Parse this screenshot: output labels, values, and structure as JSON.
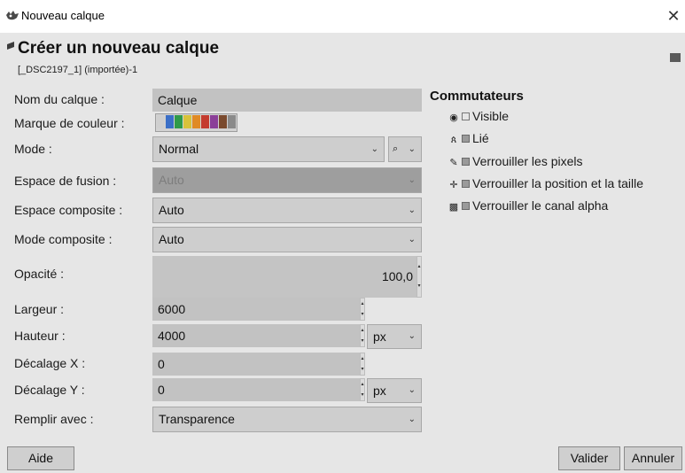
{
  "window": {
    "title": "Nouveau calque",
    "close_glyph": "✕"
  },
  "header": {
    "title": "Créer un nouveau calque",
    "subtitle": "[_DSC2197_1] (importée)-1"
  },
  "form": {
    "layer_name": {
      "label": "Nom du calque :",
      "value": "Calque"
    },
    "color_tag": {
      "label": "Marque de couleur :",
      "colors": [
        "#cfcfcf",
        "#3b6fc7",
        "#2f9a4a",
        "#d8c23a",
        "#e08a25",
        "#c43b2e",
        "#8b3f98",
        "#7a4a2e",
        "#8a8a8a"
      ]
    },
    "mode": {
      "label": "Mode :",
      "value": "Normal",
      "extra_glyph": "⌕"
    },
    "blend_space": {
      "label": "Espace de fusion :",
      "value": "Auto"
    },
    "composite_space": {
      "label": "Espace composite :",
      "value": "Auto"
    },
    "composite_mode": {
      "label": "Mode composite :",
      "value": "Auto"
    },
    "opacity": {
      "label": "Opacité :",
      "value": "100,0"
    },
    "width": {
      "label": "Largeur :",
      "value": "6000"
    },
    "height": {
      "label": "Hauteur :",
      "value": "4000",
      "unit": "px"
    },
    "offset_x": {
      "label": "Décalage X :",
      "value": "0"
    },
    "offset_y": {
      "label": "Décalage Y :",
      "value": "0",
      "unit": "px"
    },
    "fill": {
      "label": "Remplir avec :",
      "value": "Transparence"
    }
  },
  "switches": {
    "title": "Commutateurs",
    "items": [
      {
        "label": "Visible",
        "icon": "eye-icon",
        "glyph": "◉",
        "checked": false
      },
      {
        "label": "Lié",
        "icon": "chain-icon",
        "glyph": "ጰ",
        "checked": true
      },
      {
        "label": "Verrouiller les pixels",
        "icon": "brush-icon",
        "glyph": "✎",
        "checked": true
      },
      {
        "label": "Verrouiller la position et la taille",
        "icon": "move-icon",
        "glyph": "✛",
        "checked": true
      },
      {
        "label": "Verrouiller le canal alpha",
        "icon": "checkerboard-icon",
        "glyph": "▩",
        "checked": true
      }
    ]
  },
  "buttons": {
    "help": "Aide",
    "ok": "Valider",
    "cancel": "Annuler"
  },
  "glyphs": {
    "chevron": "⌄",
    "spin_up": "▴",
    "spin_down": "▾"
  }
}
